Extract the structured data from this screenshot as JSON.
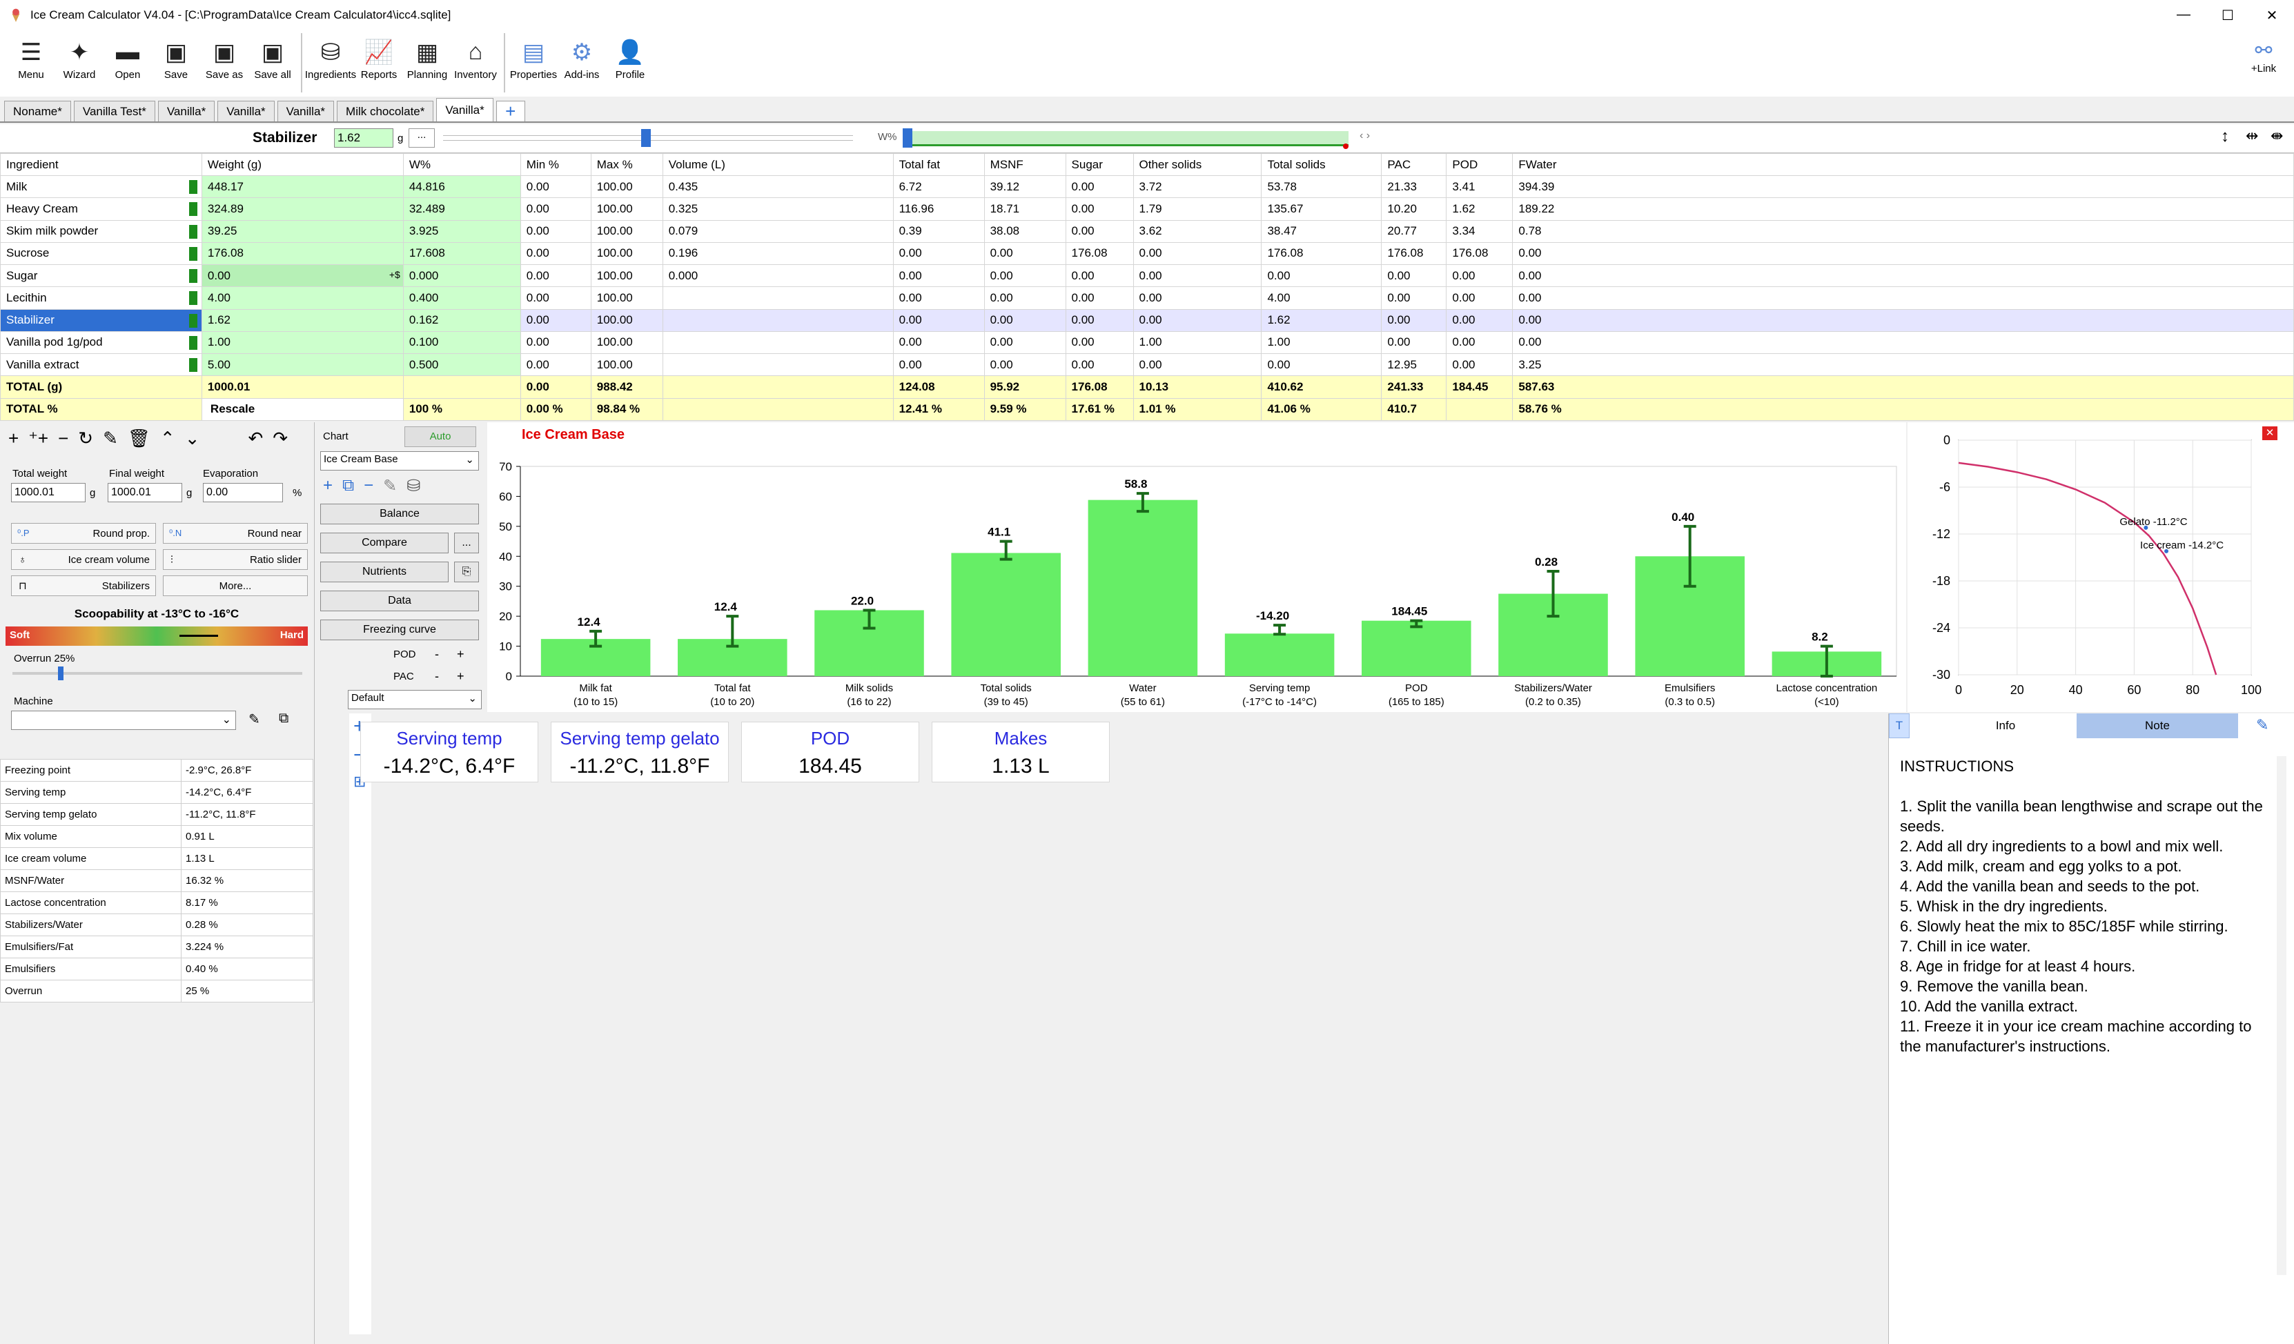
{
  "app": {
    "title": "Ice Cream Calculator V4.04   - [C:\\ProgramData\\Ice Cream Calculator4\\icc4.sqlite]",
    "min": "—",
    "max": "☐",
    "close": "✕"
  },
  "ribbon": {
    "buttons": [
      {
        "label": "Menu",
        "icon": "hamburger-icon"
      },
      {
        "label": "Wizard",
        "icon": "wizard-wand-icon"
      },
      {
        "label": "Open",
        "icon": "folder-icon"
      },
      {
        "label": "Save",
        "icon": "floppy-icon"
      },
      {
        "label": "Save as",
        "icon": "floppy-as-icon"
      },
      {
        "label": "Save all",
        "icon": "floppy-all-icon"
      },
      {
        "label": "Ingredients",
        "icon": "database-icon"
      },
      {
        "label": "Reports",
        "icon": "report-icon"
      },
      {
        "label": "Planning",
        "icon": "calendar-icon"
      },
      {
        "label": "Inventory",
        "icon": "warehouse-icon"
      },
      {
        "label": "Properties",
        "icon": "properties-icon"
      },
      {
        "label": "Add-ins",
        "icon": "addins-icon"
      },
      {
        "label": "Profile",
        "icon": "profile-icon"
      }
    ],
    "link_label": "+Link"
  },
  "tabs": [
    "Noname*",
    "Vanilla Test*",
    "Vanilla*",
    "Vanilla*",
    "Vanilla*",
    "Milk chocolate*",
    "Vanilla*"
  ],
  "stabilizer": {
    "label": "Stabilizer",
    "value": "1.62",
    "unit": "g",
    "more": "...",
    "w_label": "W%",
    "slider_pos": 0.495,
    "w_slider_pos": 0.0
  },
  "table": {
    "headers": [
      "Ingredient",
      "Weight (g)",
      "W%",
      "Min %",
      "Max %",
      "Volume (L)",
      "Total fat",
      "MSNF",
      "Sugar",
      "Other solids",
      "Total solids",
      "PAC",
      "POD",
      "FWater"
    ],
    "rows": [
      [
        "Milk",
        "448.17",
        "44.816",
        "0.00",
        "100.00",
        "0.435",
        "6.72",
        "39.12",
        "0.00",
        "3.72",
        "53.78",
        "21.33",
        "3.41",
        "394.39"
      ],
      [
        "Heavy Cream",
        "324.89",
        "32.489",
        "0.00",
        "100.00",
        "0.325",
        "116.96",
        "18.71",
        "0.00",
        "1.79",
        "135.67",
        "10.20",
        "1.62",
        "189.22"
      ],
      [
        "Skim milk powder",
        "39.25",
        "3.925",
        "0.00",
        "100.00",
        "0.079",
        "0.39",
        "38.08",
        "0.00",
        "3.62",
        "38.47",
        "20.77",
        "3.34",
        "0.78"
      ],
      [
        "Sucrose",
        "176.08",
        "17.608",
        "0.00",
        "100.00",
        "0.196",
        "0.00",
        "0.00",
        "176.08",
        "0.00",
        "176.08",
        "176.08",
        "176.08",
        "0.00"
      ],
      [
        "Sugar",
        "0.00",
        "0.000",
        "0.00",
        "100.00",
        "0.000",
        "0.00",
        "0.00",
        "0.00",
        "0.00",
        "0.00",
        "0.00",
        "0.00",
        "0.00"
      ],
      [
        "Lecithin",
        "4.00",
        "0.400",
        "0.00",
        "100.00",
        "",
        "0.00",
        "0.00",
        "0.00",
        "0.00",
        "4.00",
        "0.00",
        "0.00",
        "0.00"
      ],
      [
        "Stabilizer",
        "1.62",
        "0.162",
        "0.00",
        "100.00",
        "",
        "0.00",
        "0.00",
        "0.00",
        "0.00",
        "1.62",
        "0.00",
        "0.00",
        "0.00"
      ],
      [
        "Vanilla pod 1g/pod",
        "1.00",
        "0.100",
        "0.00",
        "100.00",
        "",
        "0.00",
        "0.00",
        "0.00",
        "1.00",
        "1.00",
        "0.00",
        "0.00",
        "0.00"
      ],
      [
        "Vanilla extract",
        "5.00",
        "0.500",
        "0.00",
        "100.00",
        "",
        "0.00",
        "0.00",
        "0.00",
        "0.00",
        "0.00",
        "12.95",
        "0.00",
        "3.25"
      ]
    ],
    "sugar_marker": "+$",
    "total_g": [
      "TOTAL (g)",
      "1000.01",
      "",
      "0.00",
      "988.42",
      "",
      "124.08",
      "95.92",
      "176.08",
      "10.13",
      "410.62",
      "241.33",
      "184.45",
      "587.63"
    ],
    "total_pct": [
      "TOTAL %",
      "Rescale",
      "100 %",
      "0.00 %",
      "98.84 %",
      "",
      "12.41 %",
      "9.59 %",
      "17.61 %",
      "1.01 %",
      "41.06 %",
      "410.7",
      "",
      "58.76 %"
    ]
  },
  "left": {
    "total_weight_label": "Total weight",
    "total_weight": "1000.01",
    "final_weight_label": "Final weight",
    "final_weight": "1000.01",
    "evaporation_label": "Evaporation",
    "evaporation": "0.00",
    "g": "g",
    "pct": "%",
    "round_prop": "Round prop.",
    "round_near": "Round near",
    "ice_cream_volume": "Ice cream volume",
    "ratio_slider": "Ratio slider",
    "stabilizers": "Stabilizers",
    "more": "More...",
    "scoop_title": "Scoopability at -13°C to -16°C",
    "soft": "Soft",
    "hard": "Hard",
    "overrun_label": "Overrun 25%",
    "machine_label": "Machine",
    "props": [
      [
        "Freezing point",
        "-2.9°C, 26.8°F"
      ],
      [
        "Serving temp",
        "-14.2°C, 6.4°F"
      ],
      [
        "Serving temp gelato",
        "-11.2°C, 11.8°F"
      ],
      [
        "Mix volume",
        "0.91 L"
      ],
      [
        "Ice cream volume",
        "1.13 L"
      ],
      [
        "MSNF/Water",
        "16.32 %"
      ],
      [
        "Lactose concentration",
        "8.17 %"
      ],
      [
        "Stabilizers/Water",
        "0.28 %"
      ],
      [
        "Emulsifiers/Fat",
        "3.224 %"
      ],
      [
        "Emulsifiers",
        "0.40 %"
      ],
      [
        "Overrun",
        "25 %"
      ]
    ]
  },
  "mid": {
    "chart_label": "Chart",
    "auto": "Auto",
    "chart_select": "Ice Cream Base",
    "balance": "Balance",
    "compare": "Compare",
    "dots": "...",
    "nutrients": "Nutrients",
    "data": "Data",
    "freezing_curve": "Freezing curve",
    "pod": "POD",
    "pac": "PAC",
    "minus": "-",
    "plus": "+",
    "default": "Default"
  },
  "chart_data": [
    {
      "type": "bar",
      "title": "Ice Cream Base",
      "categories": [
        "Milk fat",
        "Total fat",
        "Milk solids",
        "Total solids",
        "Water",
        "Serving temp",
        "POD",
        "Stabilizers/Water",
        "Emulsifiers",
        "Lactose concentration"
      ],
      "category_ranges": [
        "(10 to 15)",
        "(10 to 20)",
        "(16 to 22)",
        "(39 to 45)",
        "(55 to 61)",
        "(-17°C to -14°C)",
        "(165 to 185)",
        "(0.2 to 0.35)",
        "(0.3 to 0.5)",
        "(<10)"
      ],
      "value_labels": [
        "12.4",
        "12.4",
        "22.0",
        "41.1",
        "58.8",
        "-14.20",
        "184.45",
        "0.28",
        "0.40",
        "8.2"
      ],
      "values": [
        12.4,
        12.4,
        22.0,
        41.1,
        58.8,
        14.2,
        18.5,
        27.5,
        40.0,
        8.2
      ],
      "error_ranges": [
        [
          10,
          15
        ],
        [
          10,
          20
        ],
        [
          16,
          22
        ],
        [
          39,
          45
        ],
        [
          55,
          61
        ],
        [
          14,
          17
        ],
        [
          16.5,
          18.5
        ],
        [
          20,
          35
        ],
        [
          30,
          50
        ],
        [
          0,
          10
        ]
      ],
      "yticks": [
        0,
        10,
        20,
        30,
        40,
        50,
        60,
        70
      ],
      "ylim": [
        0,
        70
      ]
    },
    {
      "type": "line",
      "xlim": [
        0,
        100
      ],
      "ylim": [
        -30,
        0
      ],
      "xticks": [
        0,
        20,
        40,
        60,
        80,
        100
      ],
      "yticks": [
        0,
        -6,
        -12,
        -18,
        -24,
        -30
      ],
      "x": [
        0,
        10,
        20,
        30,
        40,
        50,
        60,
        65,
        70,
        75,
        80,
        85,
        88
      ],
      "y": [
        -2.9,
        -3.4,
        -4.1,
        -5.0,
        -6.3,
        -8.0,
        -10.5,
        -12.2,
        -14.5,
        -17.5,
        -21.5,
        -26.5,
        -30
      ],
      "annotations": [
        {
          "text": "Gelato -11.2°C",
          "x": 64,
          "y": -11.2
        },
        {
          "text": "Ice cream -14.2°C",
          "x": 71,
          "y": -14.2
        }
      ]
    }
  ],
  "cards": [
    {
      "title": "Serving temp",
      "value": "-14.2°C, 6.4°F"
    },
    {
      "title": "Serving temp gelato",
      "value": "-11.2°C, 11.8°F"
    },
    {
      "title": "POD",
      "value": "184.45"
    },
    {
      "title": "Makes",
      "value": "1.13 L"
    }
  ],
  "note": {
    "t": "T",
    "info_tab": "Info",
    "note_tab": "Note",
    "text": "INSTRUCTIONS\n\n1. Split the vanilla bean lengthwise and scrape out the seeds.\n2. Add all dry ingredients to a bowl and mix well.\n3. Add milk, cream and egg yolks to a pot.\n4. Add the vanilla bean and seeds to the pot.\n5. Whisk in the dry ingredients.\n6. Slowly heat the mix to 85C/185F while stirring.\n7. Chill in ice water.\n8. Age in fridge for at least 4 hours.\n9. Remove the vanilla bean.\n10. Add the vanilla extract.\n11. Freeze it in your ice cream machine according to the manufacturer's instructions."
  },
  "colors": {
    "bar": "#66ee66",
    "accent": "#2f6fd2",
    "title_red": "#e00000",
    "curve": "#d0306a"
  }
}
